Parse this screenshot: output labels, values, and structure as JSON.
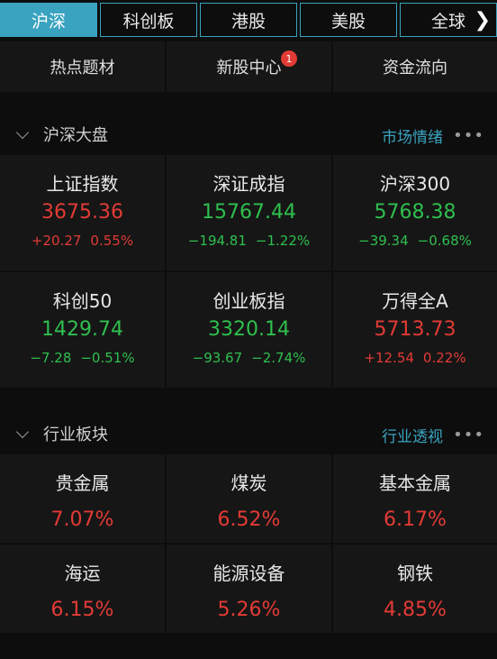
{
  "market_tabs": [
    {
      "label": "沪深",
      "active": true
    },
    {
      "label": "科创板",
      "active": false
    },
    {
      "label": "港股",
      "active": false
    },
    {
      "label": "美股",
      "active": false
    },
    {
      "label": "全球",
      "active": false
    }
  ],
  "quick_nav": [
    {
      "label": "热点题材"
    },
    {
      "label": "新股中心",
      "badge": "1"
    },
    {
      "label": "资金流向"
    }
  ],
  "market_section": {
    "title": "沪深大盘",
    "link": "市场情绪",
    "more": "•••"
  },
  "indices": [
    {
      "name": "上证指数",
      "value": "3675.36",
      "change": "+20.27",
      "pct": "0.55%",
      "dir": "up"
    },
    {
      "name": "深证成指",
      "value": "15767.44",
      "change": "−194.81",
      "pct": "−1.22%",
      "dir": "down"
    },
    {
      "name": "沪深300",
      "value": "5768.38",
      "change": "−39.34",
      "pct": "−0.68%",
      "dir": "down"
    },
    {
      "name": "科创50",
      "value": "1429.74",
      "change": "−7.28",
      "pct": "−0.51%",
      "dir": "down"
    },
    {
      "name": "创业板指",
      "value": "3320.14",
      "change": "−93.67",
      "pct": "−2.74%",
      "dir": "down"
    },
    {
      "name": "万得全A",
      "value": "5713.73",
      "change": "+12.54",
      "pct": "0.22%",
      "dir": "up"
    }
  ],
  "sector_section": {
    "title": "行业板块",
    "link": "行业透视",
    "more": "•••"
  },
  "sectors": [
    {
      "name": "贵金属",
      "pct": "7.07%",
      "dir": "up"
    },
    {
      "name": "煤炭",
      "pct": "6.52%",
      "dir": "up"
    },
    {
      "name": "基本金属",
      "pct": "6.17%",
      "dir": "up"
    },
    {
      "name": "海运",
      "pct": "6.15%",
      "dir": "up"
    },
    {
      "name": "能源设备",
      "pct": "5.26%",
      "dir": "up"
    },
    {
      "name": "钢铁",
      "pct": "4.85%",
      "dir": "up"
    }
  ],
  "colors": {
    "accent": "#3aa3bf",
    "up": "#e23b36",
    "down": "#2fbf4e"
  }
}
